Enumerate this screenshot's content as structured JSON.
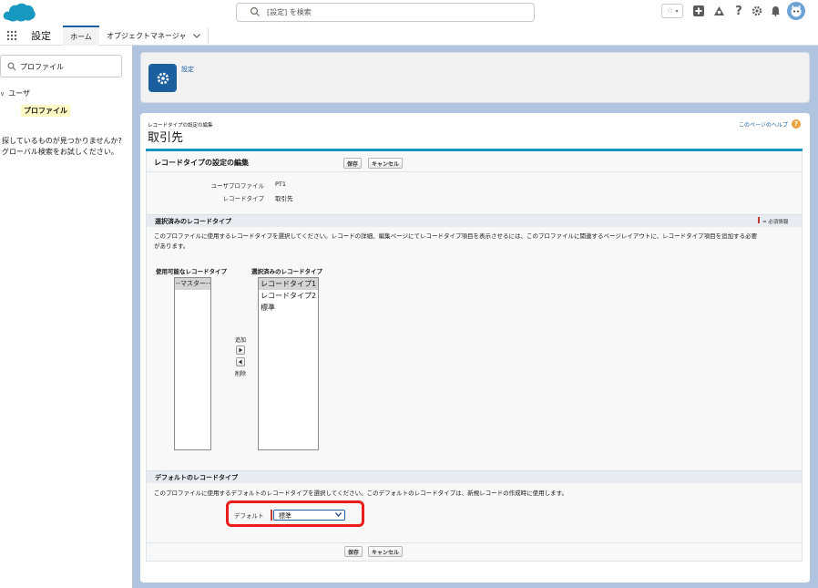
{
  "header": {
    "search_placeholder": "[設定] を検索"
  },
  "nav": {
    "app_name": "設定",
    "tabs": [
      {
        "label": "ホーム"
      },
      {
        "label": "オブジェクトマネージャ"
      }
    ]
  },
  "sidebar": {
    "search_value": "プロファイル",
    "tree_parent": "ユーザ",
    "tree_child": "プロファイル",
    "help_text_1": "探しているものが見つかりませんか?",
    "help_text_2": "グローバル検索をお試しください。"
  },
  "page_header": {
    "label": "設定"
  },
  "page": {
    "breadcrumb": "レコードタイプの設定の編集",
    "title": "取引先",
    "help_link": "このページのヘルプ",
    "help_icon_glyph": "?"
  },
  "edit_block": {
    "title": "レコードタイプの設定の編集",
    "save_label": "保存",
    "cancel_label": "キャンセル",
    "fields": [
      {
        "label": "ユーザプロファイル",
        "value": "PT1"
      },
      {
        "label": "レコードタイプ",
        "value": "取引先"
      }
    ]
  },
  "selected_section": {
    "title": "選択済みのレコードタイプ",
    "required_legend": "= 必須情報",
    "description_1": "このプロファイルに使用するレコードタイプを選択してください。レコードの詳細、編集ページにてレコードタイプ項目を表示させるには、このプロファイルに関連するページレイアウトに、レコードタイプ項目を追加する必要",
    "description_2": "があります。",
    "available_label": "使用可能なレコードタイプ",
    "selected_label": "選択済みのレコードタイプ",
    "available_items": [
      "--マスター--"
    ],
    "selected_items": [
      "レコードタイプ1",
      "レコードタイプ2",
      "標準"
    ],
    "add_label": "追加",
    "remove_label": "削除"
  },
  "default_section": {
    "title": "デフォルトのレコードタイプ",
    "description": "このプロファイルに使用するデフォルトのレコードタイプを選択してください。このデフォルトのレコードタイプは、新規レコードの作成時に使用します。",
    "default_label": "デフォルト",
    "default_value": "標準"
  },
  "colors": {
    "brand": "#1b5fa3",
    "background": "#b0c4df",
    "highlight": "#ea1c1c",
    "required": "#c23934"
  }
}
